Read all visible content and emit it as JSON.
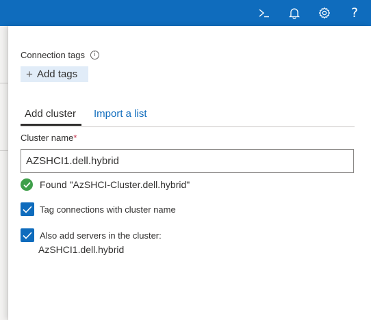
{
  "topbar": {
    "background": "#0f6cbd",
    "icons": [
      "terminal-icon",
      "bell-icon",
      "gear-icon",
      "help-icon"
    ],
    "help_glyph": "?"
  },
  "connection_tags": {
    "label": "Connection tags",
    "info_glyph": "i",
    "add_button_label": "Add tags",
    "add_button_icon": "+"
  },
  "tabs": [
    {
      "label": "Add cluster",
      "selected": true
    },
    {
      "label": "Import a list",
      "selected": false
    }
  ],
  "cluster_name": {
    "label": "Cluster name",
    "required_marker": "*",
    "value": "AZSHCI1.dell.hybrid"
  },
  "found": {
    "text": "Found \"AzSHCI-Cluster.dell.hybrid\"",
    "status_color": "#3f9f4a"
  },
  "options": {
    "tag_connections": {
      "label": "Tag connections with cluster name",
      "checked": true
    },
    "add_servers": {
      "label": "Also add servers in the cluster:",
      "checked": true
    }
  },
  "servers": [
    "AzSHCI1.dell.hybrid"
  ],
  "accent_color": "#0f6cbd"
}
